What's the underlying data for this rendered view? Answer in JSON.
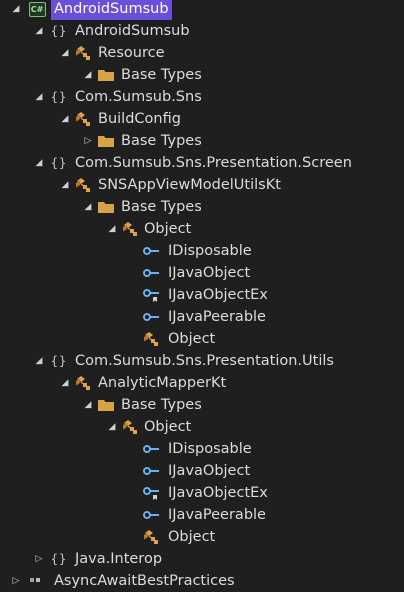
{
  "tree": [
    {
      "label": "AndroidSumsub",
      "icon": "csharp-project-icon",
      "expander": "expanded",
      "depth": 0,
      "selected": true
    },
    {
      "label": "AndroidSumsub",
      "icon": "namespace-icon",
      "expander": "expanded",
      "depth": 1
    },
    {
      "label": "Resource",
      "icon": "class-icon",
      "expander": "expanded",
      "depth": 2
    },
    {
      "label": "Base Types",
      "icon": "folder-icon",
      "expander": "expanded",
      "depth": 3
    },
    {
      "label": "Com.Sumsub.Sns",
      "icon": "namespace-icon",
      "expander": "expanded",
      "depth": 1
    },
    {
      "label": "BuildConfig",
      "icon": "class-icon",
      "expander": "expanded",
      "depth": 2
    },
    {
      "label": "Base Types",
      "icon": "folder-icon",
      "expander": "collapsed",
      "depth": 3
    },
    {
      "label": "Com.Sumsub.Sns.Presentation.Screen",
      "icon": "namespace-icon",
      "expander": "expanded",
      "depth": 1
    },
    {
      "label": "SNSAppViewModelUtilsKt",
      "icon": "class-icon",
      "expander": "expanded",
      "depth": 2
    },
    {
      "label": "Base Types",
      "icon": "folder-icon",
      "expander": "expanded",
      "depth": 3
    },
    {
      "label": "Object",
      "icon": "class-icon",
      "expander": "expanded",
      "depth": 4
    },
    {
      "label": "IDisposable",
      "icon": "interface-icon",
      "expander": "none",
      "depth": 5
    },
    {
      "label": "IJavaObject",
      "icon": "interface-icon",
      "expander": "none",
      "depth": 5
    },
    {
      "label": "IJavaObjectEx",
      "icon": "interface-internal-icon",
      "expander": "none",
      "depth": 5
    },
    {
      "label": "IJavaPeerable",
      "icon": "interface-icon",
      "expander": "none",
      "depth": 5
    },
    {
      "label": "Object",
      "icon": "class-icon",
      "expander": "none",
      "depth": 5
    },
    {
      "label": "Com.Sumsub.Sns.Presentation.Utils",
      "icon": "namespace-icon",
      "expander": "expanded",
      "depth": 1
    },
    {
      "label": "AnalyticMapperKt",
      "icon": "class-icon",
      "expander": "expanded",
      "depth": 2
    },
    {
      "label": "Base Types",
      "icon": "folder-icon",
      "expander": "expanded",
      "depth": 3
    },
    {
      "label": "Object",
      "icon": "class-icon",
      "expander": "expanded",
      "depth": 4
    },
    {
      "label": "IDisposable",
      "icon": "interface-icon",
      "expander": "none",
      "depth": 5
    },
    {
      "label": "IJavaObject",
      "icon": "interface-icon",
      "expander": "none",
      "depth": 5
    },
    {
      "label": "IJavaObjectEx",
      "icon": "interface-internal-icon",
      "expander": "none",
      "depth": 5
    },
    {
      "label": "IJavaPeerable",
      "icon": "interface-icon",
      "expander": "none",
      "depth": 5
    },
    {
      "label": "Object",
      "icon": "class-icon",
      "expander": "none",
      "depth": 5
    },
    {
      "label": "Java.Interop",
      "icon": "namespace-icon",
      "expander": "collapsed",
      "depth": 1
    },
    {
      "label": "AsyncAwaitBestPractices",
      "icon": "reference-icon",
      "expander": "collapsed",
      "depth": 0
    }
  ],
  "colors": {
    "background": "#1f1f1f",
    "text": "#dcdcdc",
    "selection": "#6b4fd8",
    "class_icon": "#e0a24a",
    "folder_icon": "#d8a441",
    "interface_icon": "#6ab0f3"
  }
}
